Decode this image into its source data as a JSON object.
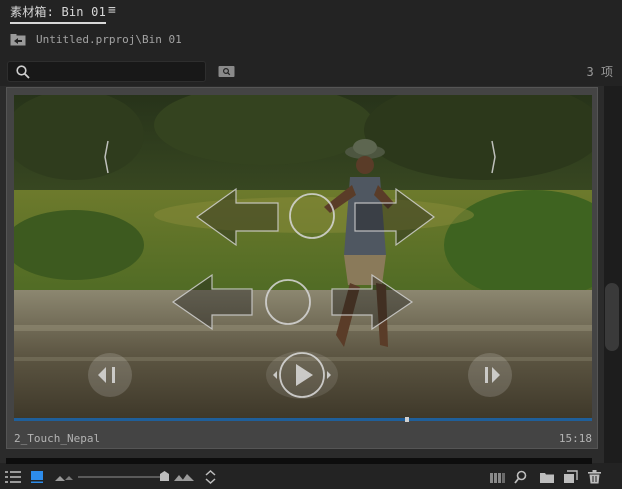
{
  "header": {
    "tab_label": "素材箱: Bin 01",
    "menu_icon": "≡"
  },
  "path": {
    "text": "Untitled.prproj\\Bin 01"
  },
  "search": {
    "value": "",
    "placeholder": ""
  },
  "item_count": "3 项",
  "clip": {
    "name": "2_Touch_Nepal",
    "duration": "15:18",
    "playhead_fraction": 0.68
  },
  "colors": {
    "accent": "#1f5f9a",
    "panel_bg": "#232323",
    "card_bg": "#444444"
  },
  "icons": [
    "search-icon",
    "find-icon",
    "folder-up-icon",
    "list-view-icon",
    "icon-view-icon",
    "freeform-view-icon",
    "zoom-small-icon",
    "zoom-large-icon",
    "sort-icon",
    "automate-icon",
    "find-footer-icon",
    "new-bin-icon",
    "new-item-icon",
    "delete-icon"
  ]
}
